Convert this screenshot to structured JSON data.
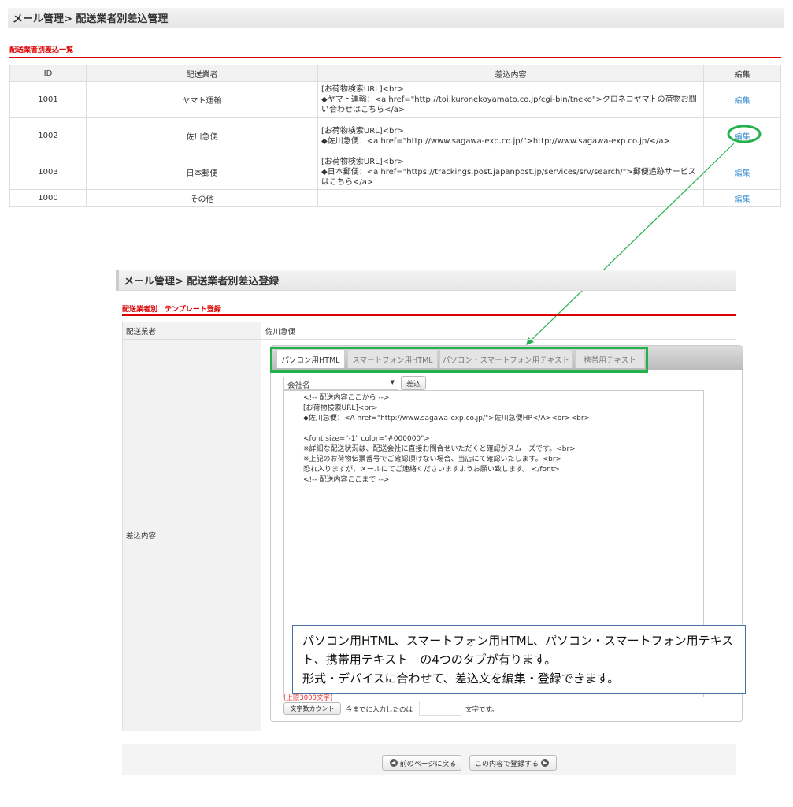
{
  "list_page": {
    "title": "メール管理> 配送業者別差込管理",
    "section": "配送業者別差込一覧",
    "headers": [
      "ID",
      "配送業者",
      "差込内容",
      "編集"
    ],
    "rows": [
      {
        "id": "1001",
        "carrier": "ヤマト運輸",
        "content": "[お荷物検索URL]<br>\n◆ヤマト運輸：<a href=\"http://toi.kuronekoyamato.co.jp/cgi-bin/tneko\">クロネコヤマトの荷物お問い合わせはこちら</a>",
        "edit": "編集"
      },
      {
        "id": "1002",
        "carrier": "佐川急便",
        "content": "[お荷物検索URL]<br>\n◆佐川急便：<a href=\"http://www.sagawa-exp.co.jp/\">http://www.sagawa-exp.co.jp/</a>",
        "edit": "編集"
      },
      {
        "id": "1003",
        "carrier": "日本郵便",
        "content": "[お荷物検索URL]<br>\n◆日本郵便：<a href=\"https://trackings.post.japanpost.jp/services/srv/search/\">郵便追跡サービスはこちら</a>",
        "edit": "編集"
      },
      {
        "id": "1000",
        "carrier": "その他",
        "content": "",
        "edit": "編集"
      }
    ]
  },
  "form_page": {
    "title": "メール管理> 配送業者別差込登録",
    "section": "配送業者別　テンプレート登録",
    "carrier_label": "配送業者",
    "carrier_value": "佐川急便",
    "content_label": "差込内容",
    "tabs": [
      "パソコン用HTML",
      "スマートフォン用HTML",
      "パソコン・スマートフォン用テキスト",
      "携帯用テキスト"
    ],
    "select_value": "会社名",
    "insert_button": "差込",
    "textarea": "<!-- 配送内容ここから -->\n[お荷物検索URL]<br>\n◆佐川急便：<A href=\"http://www.sagawa-exp.co.jp/\">佐川急便HP</A><br><br>\n\n<font size=\"-1\" color=\"#000000\">\n※詳細な配送状況は、配送会社に直接お問合せいただくと確認がスムーズです。<br>\n※上記のお荷物伝票番号でご確認頂けない場合、当店にて確認いたします。<br>\n恐れ入りますが、メールにてご連絡くださいますようお願い致します。 </font>\n<!-- 配送内容ここまで -->",
    "limit": "(上限3000文字)",
    "count_button": "文字数カウント",
    "count_prefix": "今までに入力したのは",
    "count_suffix": "文字です。",
    "back_button": "前のページに戻る",
    "submit_button": "この内容で登録する"
  },
  "annotation": "パソコン用HTML、スマートフォン用HTML、パソコン・スマートフォン用テキスト、携帯用テキスト　の4つのタブが有ります。\n形式・デバイスに合わせて、差込文を編集・登録できます。",
  "colors": {
    "accent_red": "#dd0000",
    "link": "#3a8fd0",
    "highlight_green": "#22b14c"
  }
}
